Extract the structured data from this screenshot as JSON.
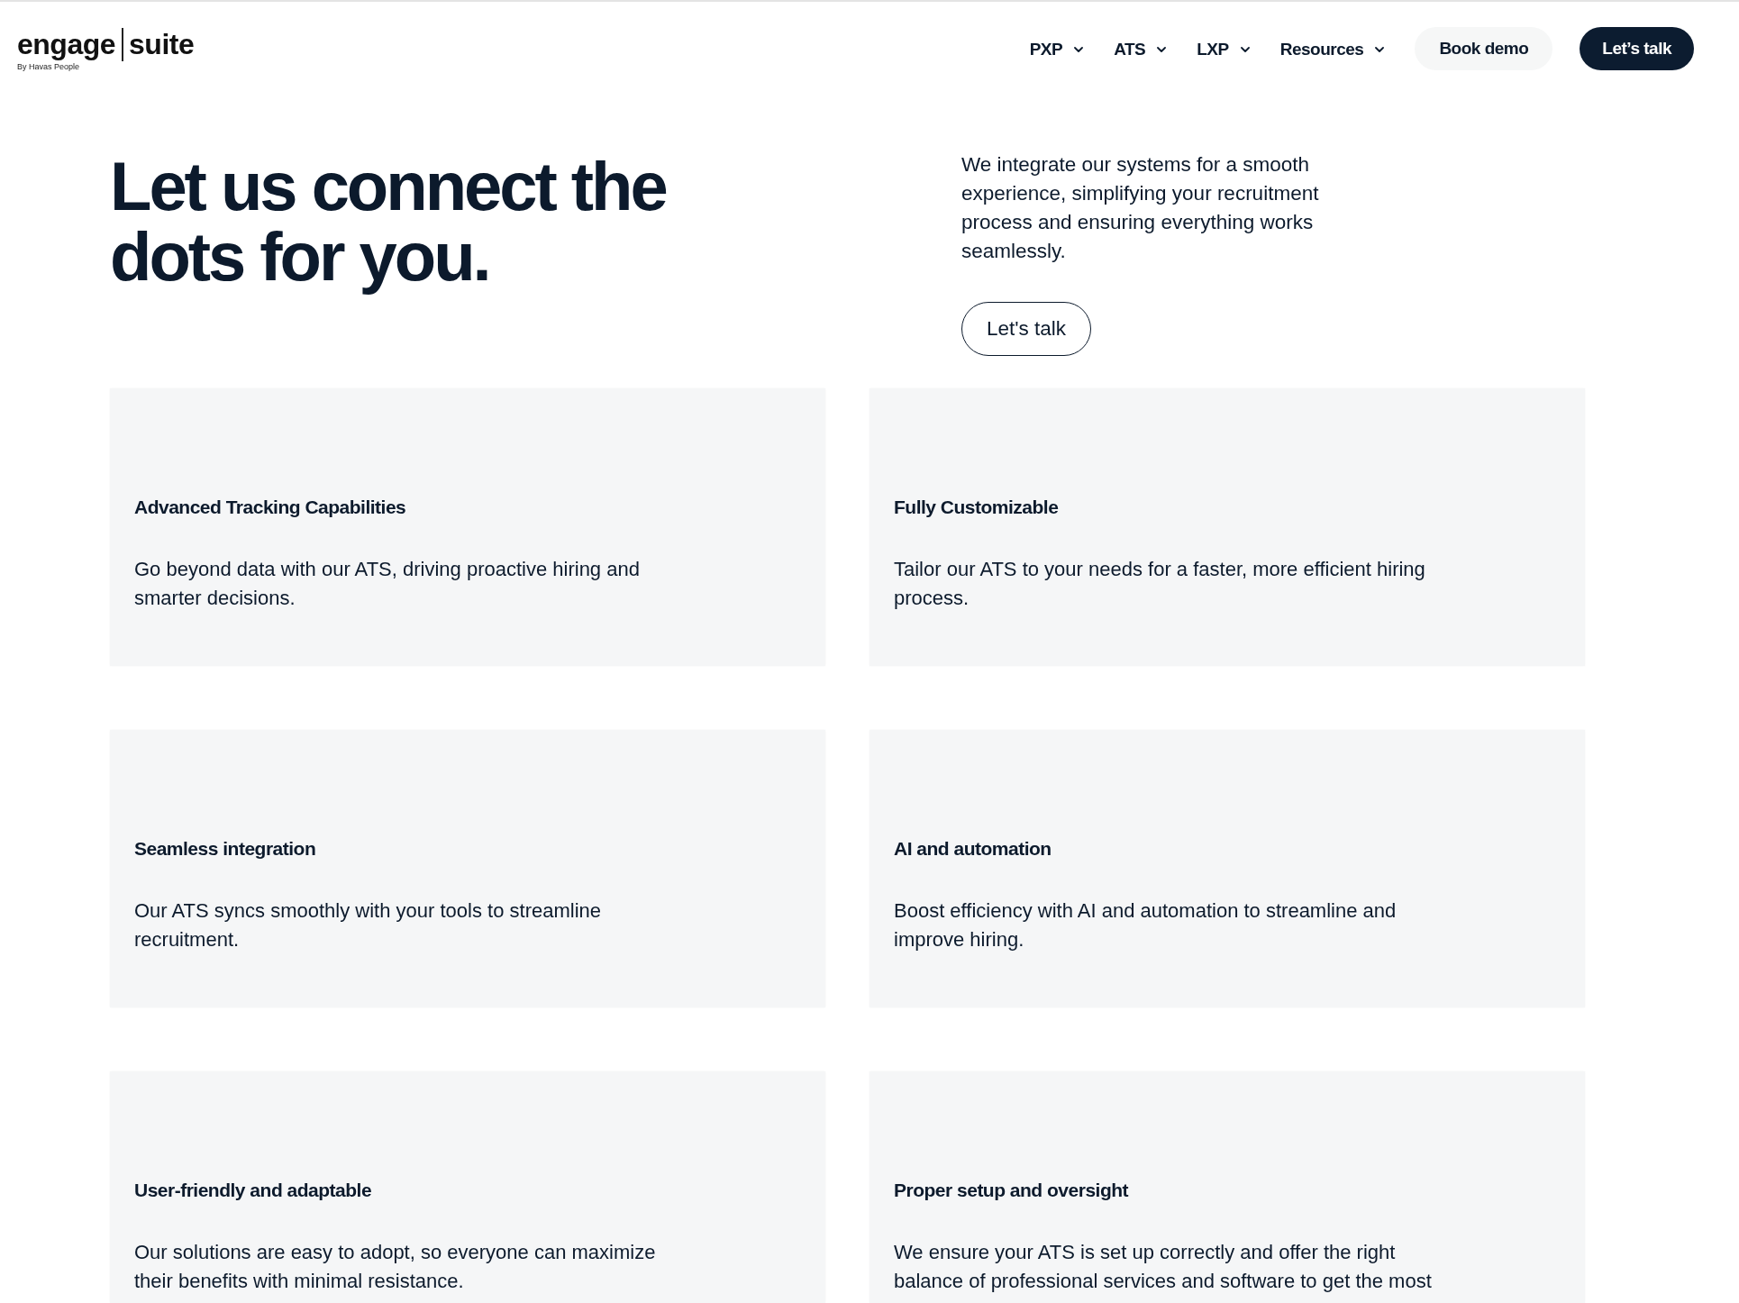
{
  "header": {
    "logo": {
      "word_left": "engage",
      "word_right": "suite",
      "tagline": "By Havas People"
    },
    "nav": [
      {
        "label": "PXP"
      },
      {
        "label": "ATS"
      },
      {
        "label": "LXP"
      },
      {
        "label": "Resources"
      }
    ],
    "buttons": [
      {
        "label": "Book demo",
        "kind": "secondary"
      },
      {
        "label": "Let’s talk",
        "kind": "primary"
      }
    ]
  },
  "hero": {
    "heading": "Let us connect the dots for you.",
    "text": "We integrate our systems for a smooth experience, simplifying your recruitment process and ensuring everything works seamlessly.",
    "button": "Let's talk"
  },
  "features": [
    {
      "title": "Advanced Tracking Capabilities",
      "description": "Go beyond data with our ATS, driving proactive hiring and smarter decisions."
    },
    {
      "title": "Fully Customizable",
      "description": "Tailor our ATS to your needs for a faster, more efficient hiring process."
    },
    {
      "title": "Seamless integration",
      "description": "Our ATS syncs smoothly with your tools to streamline recruitment."
    },
    {
      "title": "AI and automation",
      "description": "Boost efficiency with AI and automation to streamline and improve hiring."
    },
    {
      "title": "User-friendly and adaptable",
      "description": "Our solutions are easy to adopt, so everyone can maximize their benefits with minimal resistance."
    },
    {
      "title": "Proper setup and oversight",
      "description": "We ensure your ATS is set up correctly and offer the right balance of professional services and software to get the most"
    }
  ]
}
